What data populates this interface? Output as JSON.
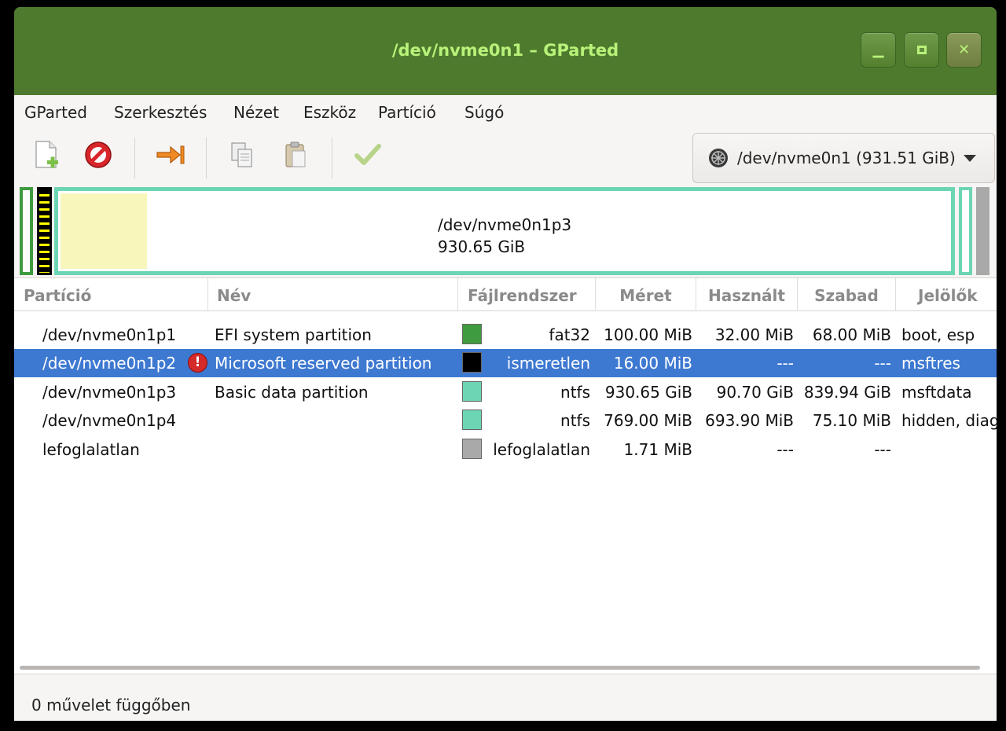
{
  "window": {
    "title": "/dev/nvme0n1 – GParted"
  },
  "menu": [
    "GParted",
    "Szerkesztés",
    "Nézet",
    "Eszköz",
    "Partíció",
    "Súgó"
  ],
  "toolbar": {
    "icons": [
      "new-partition-icon",
      "delete-icon",
      "resize-move-icon",
      "copy-icon",
      "paste-icon",
      "apply-icon"
    ],
    "device": "/dev/nvme0n1 (931.51 GiB)"
  },
  "diskmap": {
    "selected_name": "/dev/nvme0n1p3",
    "selected_size": "930.65 GiB"
  },
  "columns": [
    "Partíció",
    "Név",
    "Fájlrendszer",
    "Méret",
    "Használt",
    "Szabad",
    "Jelölők"
  ],
  "rows": [
    {
      "partition": "/dev/nvme0n1p1",
      "name": "EFI system partition",
      "fs": "fat32",
      "fs_color": "#3f9b3f",
      "size": "100.00 MiB",
      "used": "32.00 MiB",
      "free": "68.00 MiB",
      "flags": "boot, esp"
    },
    {
      "partition": "/dev/nvme0n1p2",
      "name": "Microsoft reserved partition",
      "fs": "ismeretlen",
      "fs_color": "#000000",
      "size": "16.00 MiB",
      "used": "---",
      "free": "---",
      "flags": "msftres",
      "warning": true
    },
    {
      "partition": "/dev/nvme0n1p3",
      "name": "Basic data partition",
      "fs": "ntfs",
      "fs_color": "#6cd5b3",
      "size": "930.65 GiB",
      "used": "90.70 GiB",
      "free": "839.94 GiB",
      "flags": "msftdata"
    },
    {
      "partition": "/dev/nvme0n1p4",
      "name": "",
      "fs": "ntfs",
      "fs_color": "#6cd5b3",
      "size": "769.00 MiB",
      "used": "693.90 MiB",
      "free": "75.10 MiB",
      "flags": "hidden, diag"
    },
    {
      "partition": "lefoglalatlan",
      "name": "",
      "fs": "lefoglalatlan",
      "fs_color": "#a9a9a9",
      "size": "1.71 MiB",
      "used": "---",
      "free": "---",
      "flags": ""
    }
  ],
  "status": "0 művelet függőben"
}
